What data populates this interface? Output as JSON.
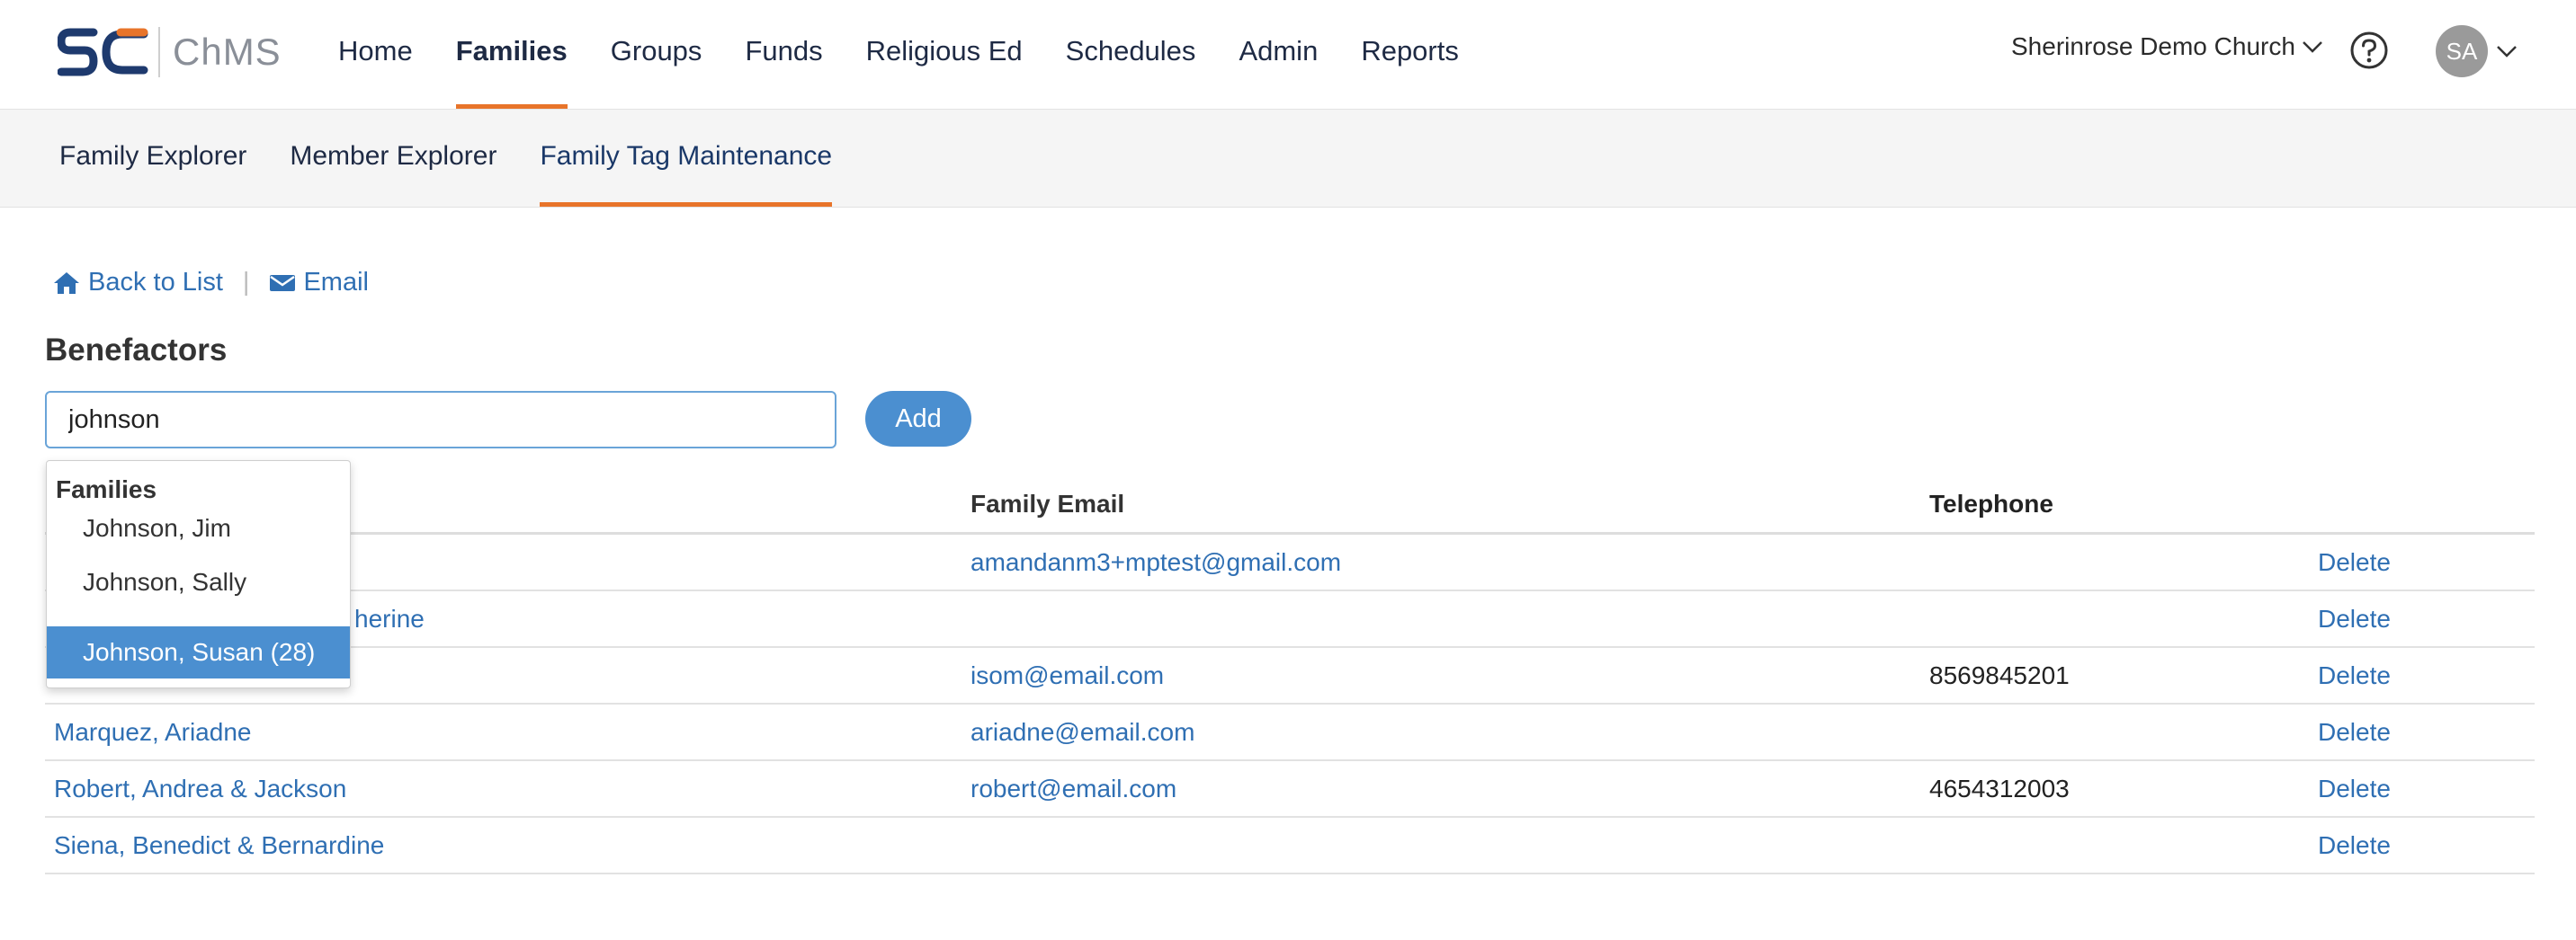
{
  "app": {
    "logo_text": "ChMS"
  },
  "nav": {
    "items": [
      {
        "label": "Home",
        "active": false
      },
      {
        "label": "Families",
        "active": true
      },
      {
        "label": "Groups",
        "active": false
      },
      {
        "label": "Funds",
        "active": false
      },
      {
        "label": "Religious Ed",
        "active": false
      },
      {
        "label": "Schedules",
        "active": false
      },
      {
        "label": "Admin",
        "active": false
      },
      {
        "label": "Reports",
        "active": false
      }
    ],
    "org_name": "Sherinrose Demo Church",
    "user_initials": "SA"
  },
  "subnav": {
    "items": [
      {
        "label": "Family Explorer",
        "active": false
      },
      {
        "label": "Member Explorer",
        "active": false
      },
      {
        "label": "Family Tag Maintenance",
        "active": true
      }
    ]
  },
  "actions": {
    "back_label": "Back to List",
    "email_label": "Email"
  },
  "page": {
    "title": "Benefactors"
  },
  "search": {
    "value": "johnson",
    "add_label": "Add"
  },
  "table": {
    "headers": [
      "",
      "Family Email",
      "Telephone",
      ""
    ],
    "rows": [
      {
        "name": "",
        "email": "amandanm3+mptest@gmail.com",
        "phone": "",
        "action": "Delete"
      },
      {
        "name": "herine",
        "email": "",
        "phone": "",
        "action": "Delete"
      },
      {
        "name": "",
        "email": "isom@email.com",
        "phone": "8569845201",
        "action": "Delete"
      },
      {
        "name": "Marquez, Ariadne",
        "email": "ariadne@email.com",
        "phone": "",
        "action": "Delete"
      },
      {
        "name": "Robert, Andrea & Jackson",
        "email": "robert@email.com",
        "phone": "4654312003",
        "action": "Delete"
      },
      {
        "name": "Siena, Benedict & Bernardine",
        "email": "",
        "phone": "",
        "action": "Delete"
      }
    ]
  },
  "dropdown": {
    "header": "Families",
    "items": [
      {
        "label": "Johnson, Jim",
        "selected": false
      },
      {
        "label": "Johnson, Sally",
        "selected": false
      },
      {
        "label": "Johnson, Susan (28)",
        "selected": true
      }
    ]
  },
  "colors": {
    "accent": "#e8742a",
    "link": "#2f6fb3",
    "button": "#4b8fd0",
    "nav_text": "#1e2a44"
  }
}
